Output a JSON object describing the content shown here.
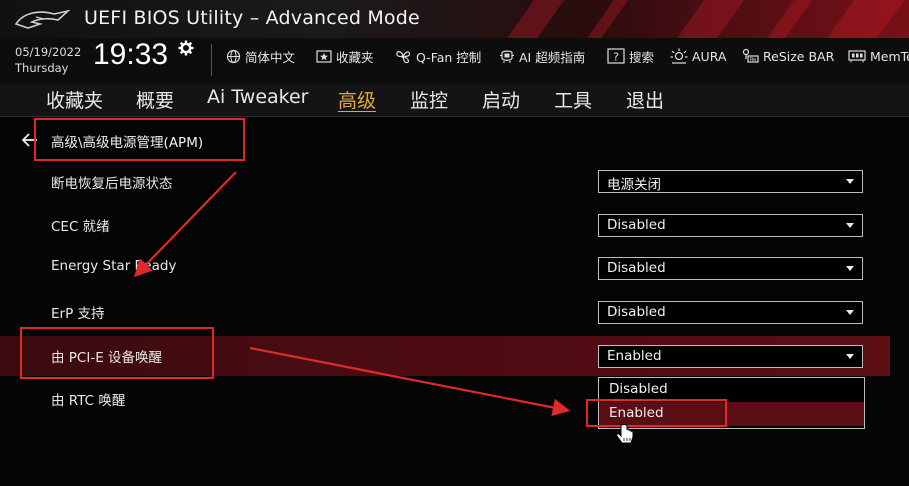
{
  "window": {
    "title": "UEFI BIOS Utility – Advanced Mode"
  },
  "status": {
    "date": "05/19/2022",
    "weekday": "Thursday",
    "time": "19:33"
  },
  "toolbar": {
    "language": "简体中文",
    "favorites": "收藏夹",
    "qfan": "Q-Fan 控制",
    "ai_oc": "AI 超频指南",
    "search": "搜索",
    "aura": "AURA",
    "resize_bar": "ReSize BAR",
    "memtest": "MemTest"
  },
  "menu": {
    "favorites": "收藏夹",
    "main": "概要",
    "ai_tweaker": "Ai Tweaker",
    "advanced": "高级",
    "monitor": "监控",
    "boot": "启动",
    "tool": "工具",
    "exit": "退出"
  },
  "breadcrumb": "高级\\高级电源管理(APM)",
  "settings": {
    "restore_ac": {
      "label": "断电恢复后电源状态",
      "value": "电源关闭"
    },
    "cec": {
      "label": "CEC 就绪",
      "value": "Disabled"
    },
    "energy_star": {
      "label": "Energy Star Ready",
      "value": "Disabled"
    },
    "erp": {
      "label": "ErP 支持",
      "value": "Disabled"
    },
    "pcie_wake": {
      "label": "由 PCI-E 设备唤醒",
      "value": "Enabled"
    },
    "rtc_wake": {
      "label": "由 RTC 唤醒"
    }
  },
  "popup_options": {
    "opt1": "Disabled",
    "opt2": "Enabled"
  },
  "colors": {
    "accent": "#e0a93a",
    "brand_red": "#c81e28",
    "annotation": "#e02a2a"
  },
  "icons": [
    "rog-logo",
    "gear-icon",
    "globe-icon",
    "favorites-icon",
    "fan-icon",
    "ai-oc-icon",
    "help-icon",
    "aura-icon",
    "resize-bar-icon",
    "memtest-icon",
    "back-arrow-icon",
    "caret-down-icon",
    "hand-cursor-icon"
  ]
}
